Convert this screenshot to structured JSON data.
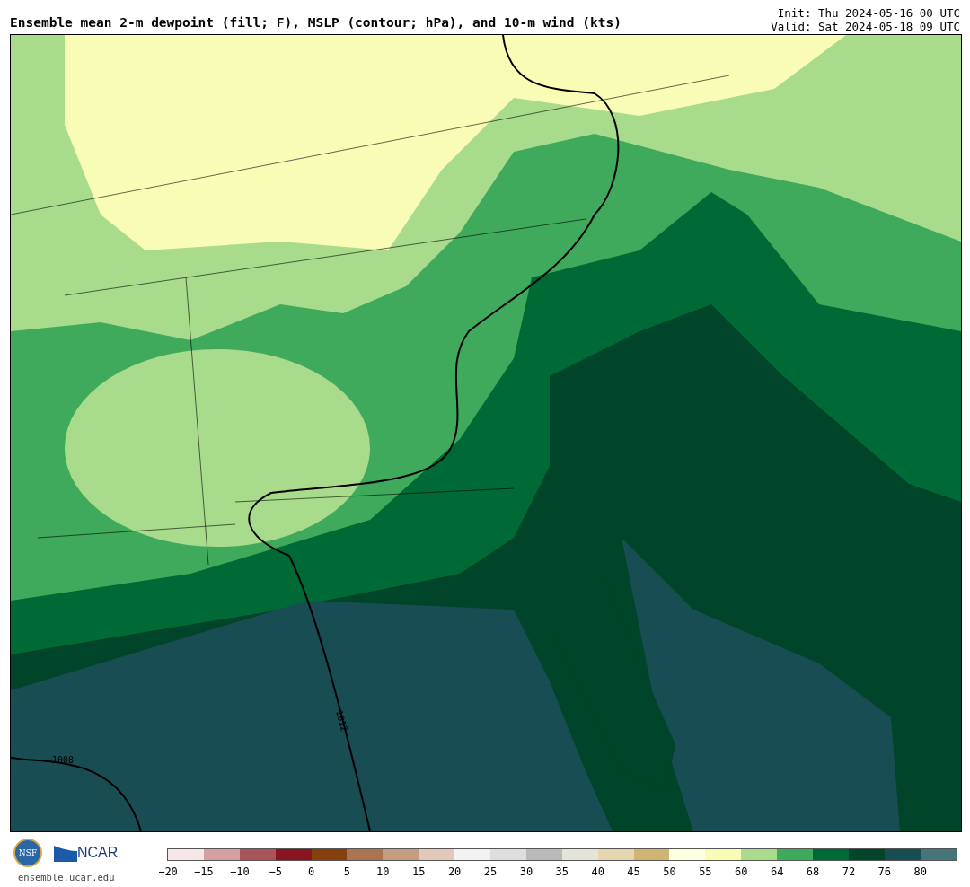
{
  "title": "Ensemble mean 2-m dewpoint (fill; F), MSLP (contour; hPa), and 10-m wind (kts)",
  "init": "Init: Thu 2024-05-16 00 UTC",
  "valid": "Valid: Sat 2024-05-18 09 UTC",
  "map": {
    "contour_labels": [
      {
        "text": "1012",
        "kind": "tilted"
      },
      {
        "text": "1008",
        "kind": "flat"
      }
    ]
  },
  "footer": {
    "logo_text": "NSF",
    "brand": "NCAR",
    "site": "ensemble.ucar.edu"
  },
  "colorbar": [
    {
      "label": "−20",
      "color": "#f5e6e8"
    },
    {
      "label": "−15",
      "color": "#d4a0a4"
    },
    {
      "label": "−10",
      "color": "#a85458"
    },
    {
      "label": "−5",
      "color": "#8a1520"
    },
    {
      "label": "0",
      "color": "#86400e"
    },
    {
      "label": "5",
      "color": "#a97451"
    },
    {
      "label": "10",
      "color": "#c49c80"
    },
    {
      "label": "15",
      "color": "#e2c8b8"
    },
    {
      "label": "20",
      "color": "#f2f2f2"
    },
    {
      "label": "25",
      "color": "#dedede"
    },
    {
      "label": "30",
      "color": "#bababa"
    },
    {
      "label": "35",
      "color": "#e4e4d8"
    },
    {
      "label": "40",
      "color": "#e6d6b0"
    },
    {
      "label": "45",
      "color": "#d0b474"
    },
    {
      "label": "50",
      "color": "#fefee0"
    },
    {
      "label": "55",
      "color": "#f8fcb4"
    },
    {
      "label": "60",
      "color": "#a8dc8c"
    },
    {
      "label": "64",
      "color": "#40aa5c"
    },
    {
      "label": "68",
      "color": "#006a36"
    },
    {
      "label": "72",
      "color": "#004429"
    },
    {
      "label": "76",
      "color": "#194d54"
    },
    {
      "label": "80",
      "color": "#457579"
    }
  ]
}
